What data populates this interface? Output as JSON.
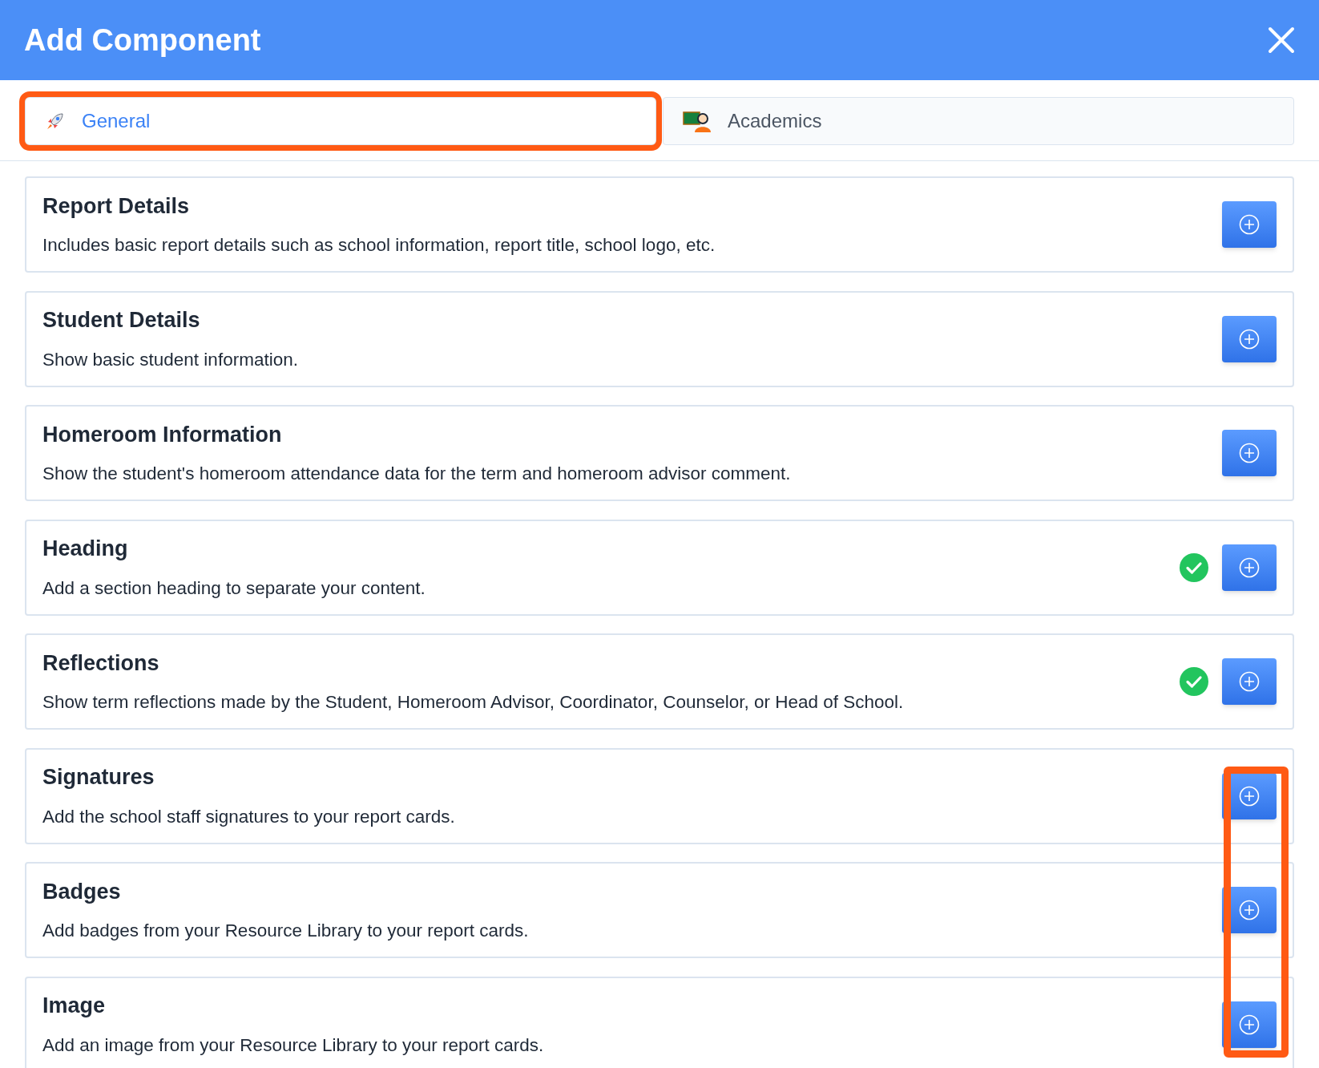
{
  "window": {
    "title": "Add Component"
  },
  "tabs": [
    {
      "label": "General",
      "selected": true,
      "highlighted": true
    },
    {
      "label": "Academics",
      "selected": false,
      "highlighted": false
    }
  ],
  "components": [
    {
      "title": "Report Details",
      "description": "Includes basic report details such as school information, report title, school logo, etc.",
      "added": false,
      "highlighted": false
    },
    {
      "title": "Student Details",
      "description": "Show basic student information.",
      "added": false,
      "highlighted": false
    },
    {
      "title": "Homeroom Information",
      "description": "Show the student's homeroom attendance data for the term and homeroom advisor comment.",
      "added": false,
      "highlighted": false
    },
    {
      "title": "Heading",
      "description": "Add a section heading to separate your content.",
      "added": true,
      "highlighted": false
    },
    {
      "title": "Reflections",
      "description": "Show term reflections made by the Student, Homeroom Advisor, Coordinator, Counselor, or Head of School.",
      "added": true,
      "highlighted": false
    },
    {
      "title": "Signatures",
      "description": "Add the school staff signatures to your report cards.",
      "added": false,
      "highlighted": true
    },
    {
      "title": "Badges",
      "description": "Add badges from your Resource Library to your report cards.",
      "added": false,
      "highlighted": true
    },
    {
      "title": "Image",
      "description": "Add an image from your Resource Library to your report cards.",
      "added": false,
      "highlighted": true
    }
  ]
}
